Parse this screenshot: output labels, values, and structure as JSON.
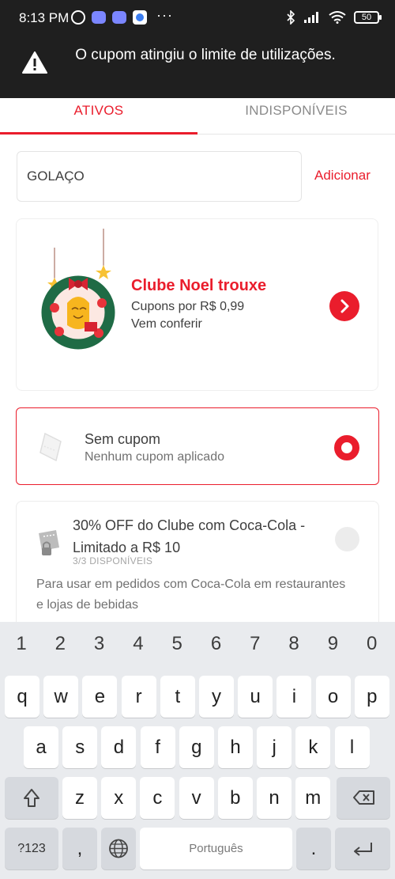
{
  "status_bar": {
    "time": "8:13 PM",
    "battery": "50"
  },
  "toast": {
    "message": "O cupom atingiu o limite de utilizações."
  },
  "tabs": [
    {
      "label": "ATIVOS",
      "active": true
    },
    {
      "label": "INDISPONÍVEIS",
      "active": false
    }
  ],
  "coupon_form": {
    "value": "GOLAÇO",
    "add_label": "Adicionar"
  },
  "banner": {
    "title": "Clube Noel trouxe",
    "line1": "Cupons por R$ 0,99",
    "line2": "Vem conferir"
  },
  "no_coupon": {
    "title": "Sem cupom",
    "subtitle": "Nenhum cupom aplicado"
  },
  "coupon": {
    "title": "30% OFF do Clube com Coca-Cola - Limitado a R$ 10",
    "availability": "3/3 DISPONÍVEIS",
    "description": "Para usar em pedidos com Coca-Cola em restaurantes e lojas de bebidas"
  },
  "colors": {
    "accent": "#EA1D2C",
    "dark_bar": "#1F1F1F"
  },
  "keyboard": {
    "numbers": [
      "1",
      "2",
      "3",
      "4",
      "5",
      "6",
      "7",
      "8",
      "9",
      "0"
    ],
    "row1": [
      "q",
      "w",
      "e",
      "r",
      "t",
      "y",
      "u",
      "i",
      "o",
      "p"
    ],
    "row2": [
      "a",
      "s",
      "d",
      "f",
      "g",
      "h",
      "j",
      "k",
      "l"
    ],
    "row3": [
      "z",
      "x",
      "c",
      "v",
      "b",
      "n",
      "m"
    ],
    "symbols_label": "?123",
    "comma": ",",
    "space_label": "Português",
    "period": "."
  }
}
